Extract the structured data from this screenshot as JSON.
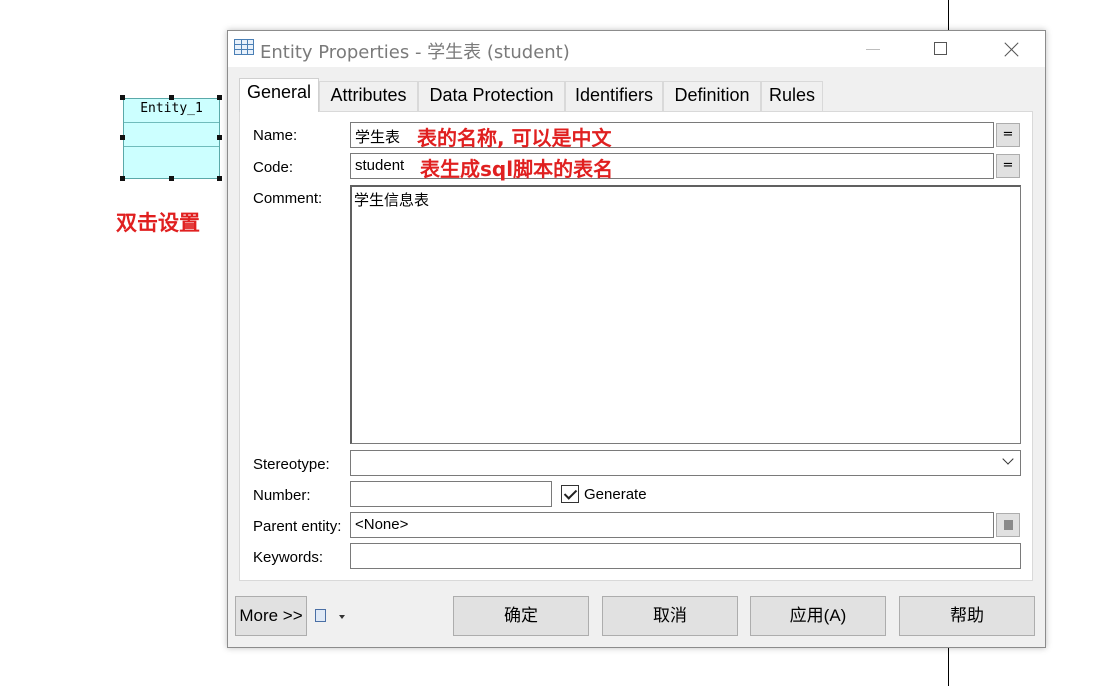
{
  "canvas": {
    "entity_name": "Entity_1",
    "annotation": "双击设置"
  },
  "dialog": {
    "title": "Entity Properties - 学生表 (student)",
    "tabs": [
      "General",
      "Attributes",
      "Data Protection",
      "Identifiers",
      "Definition",
      "Rules"
    ],
    "active_tab": "General",
    "labels": {
      "name": "Name:",
      "code": "Code:",
      "comment": "Comment:",
      "stereotype": "Stereotype:",
      "number": "Number:",
      "parent_entity": "Parent entity:",
      "keywords": "Keywords:"
    },
    "values": {
      "name": "学生表",
      "code": "student",
      "comment": "学生信息表",
      "stereotype": "",
      "number": "",
      "parent_entity": "<None>",
      "keywords": ""
    },
    "generate_checkbox": {
      "label": "Generate",
      "checked": true
    },
    "equals_label": "=",
    "annotations": {
      "name": "表的名称, 可以是中文",
      "code": "表生成sql脚本的表名"
    },
    "buttons": {
      "more": "More >>",
      "ok": "确定",
      "cancel": "取消",
      "apply": "应用(A)",
      "help": "帮助"
    }
  },
  "colors": {
    "annotation_red": "#e02020",
    "entity_fill": "#ccffff"
  }
}
